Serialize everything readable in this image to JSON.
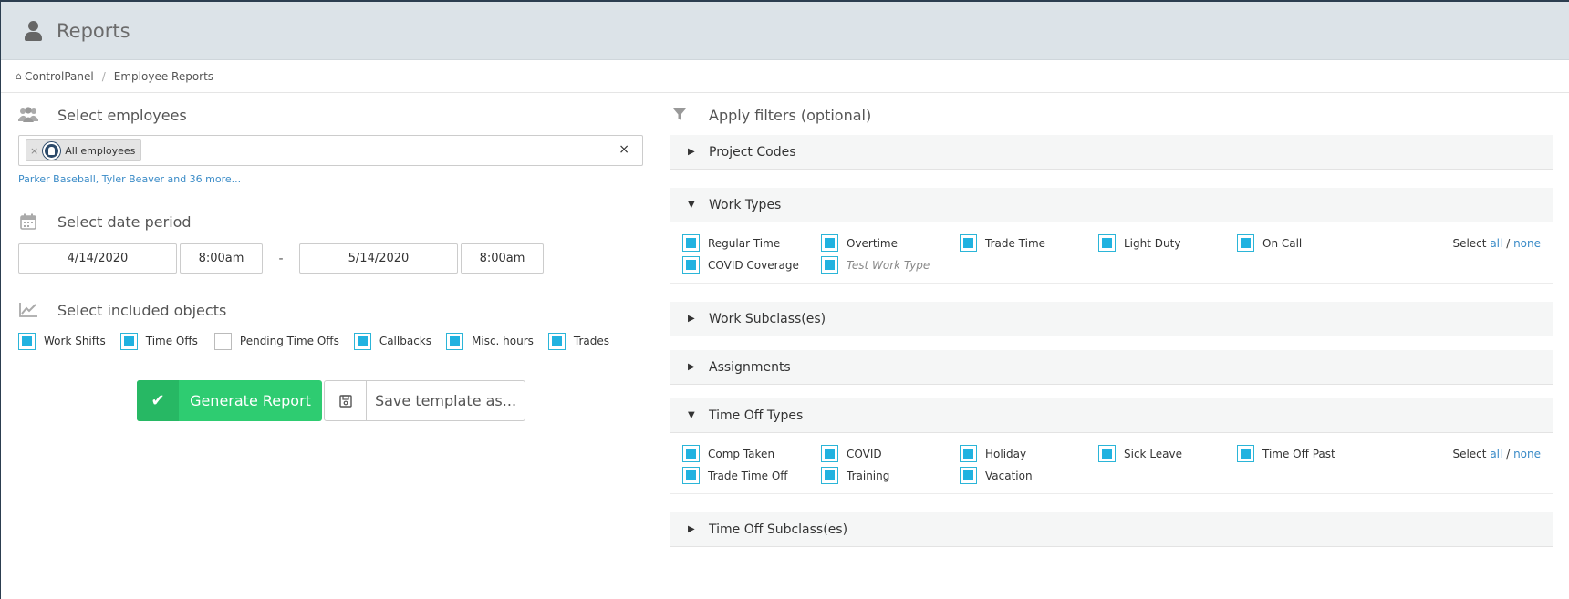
{
  "header": {
    "title": "Reports",
    "icon": "user-icon"
  },
  "breadcrumb": {
    "home": "ControlPanel",
    "current": "Employee Reports",
    "home_icon": "home-icon"
  },
  "employees": {
    "title": "Select employees",
    "icon": "users-icon",
    "tag_label": "All employees",
    "tag_remove": "×",
    "clear": "×",
    "summary_link": "Parker Baseball, Tyler Beaver and 36 more..."
  },
  "date_period": {
    "title": "Select date period",
    "icon": "calendar-icon",
    "start_date": "4/14/2020",
    "start_time": "8:00am",
    "separator": "-",
    "end_date": "5/14/2020",
    "end_time": "8:00am"
  },
  "objects": {
    "title": "Select included objects",
    "icon": "chart-icon",
    "items": [
      {
        "label": "Work Shifts",
        "checked": true
      },
      {
        "label": "Time Offs",
        "checked": true
      },
      {
        "label": "Pending Time Offs",
        "checked": false
      },
      {
        "label": "Callbacks",
        "checked": true
      },
      {
        "label": "Misc. hours",
        "checked": true
      },
      {
        "label": "Trades",
        "checked": true
      }
    ]
  },
  "actions": {
    "generate": "Generate Report",
    "save": "Save template as..."
  },
  "filters": {
    "title": "Apply filters (optional)",
    "icon": "filter-icon",
    "select_prefix": "Select",
    "select_all": "all",
    "select_divider": "/",
    "select_none": "none",
    "panels": {
      "project_codes": "Project Codes",
      "work_types": "Work Types",
      "work_subclasses": "Work Subclass(es)",
      "assignments": "Assignments",
      "time_off_types": "Time Off Types",
      "time_off_subclasses": "Time Off Subclass(es)"
    },
    "work_types": [
      {
        "label": "Regular Time",
        "checked": true
      },
      {
        "label": "Overtime",
        "checked": true
      },
      {
        "label": "Trade Time",
        "checked": true
      },
      {
        "label": "Light Duty",
        "checked": true
      },
      {
        "label": "On Call",
        "checked": true
      },
      {
        "label": "COVID Coverage",
        "checked": true
      },
      {
        "label": "Test Work Type",
        "checked": true,
        "italic": true
      }
    ],
    "time_off_types": [
      {
        "label": "Comp Taken",
        "checked": true
      },
      {
        "label": "COVID",
        "checked": true
      },
      {
        "label": "Holiday",
        "checked": true
      },
      {
        "label": "Sick Leave",
        "checked": true
      },
      {
        "label": "Time Off Past",
        "checked": true
      },
      {
        "label": "Trade Time Off",
        "checked": true
      },
      {
        "label": "Training",
        "checked": true
      },
      {
        "label": "Vacation",
        "checked": true
      }
    ]
  },
  "colors": {
    "accent": "#20b2e0",
    "success": "#2ecc71",
    "link": "#3a8bc7",
    "header_bg": "#dce3e8"
  }
}
